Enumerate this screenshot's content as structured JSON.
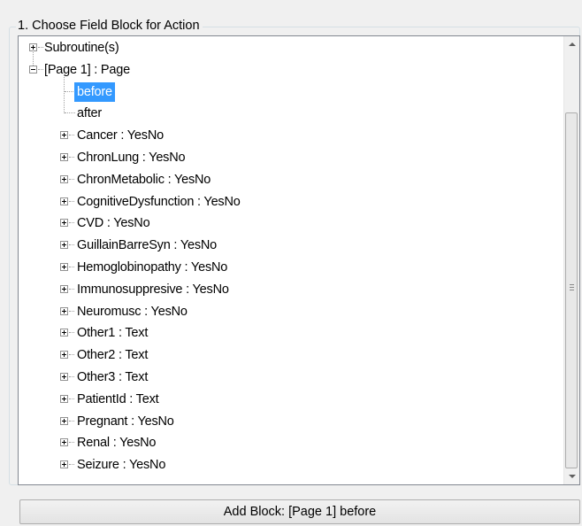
{
  "groupbox": {
    "title": "1. Choose Field Block for Action"
  },
  "tree": {
    "root_nodes": [
      {
        "label": "Subroutine(s)",
        "expanded": false
      },
      {
        "label": "[Page 1] : Page",
        "expanded": true
      }
    ],
    "page_children": [
      {
        "label": "before",
        "selected": true,
        "expander": false
      },
      {
        "label": "after",
        "selected": false,
        "expander": false
      },
      {
        "label": "Cancer : YesNo",
        "expander": true
      },
      {
        "label": "ChronLung : YesNo",
        "expander": true
      },
      {
        "label": "ChronMetabolic : YesNo",
        "expander": true
      },
      {
        "label": "CognitiveDysfunction : YesNo",
        "expander": true
      },
      {
        "label": "CVD : YesNo",
        "expander": true
      },
      {
        "label": "GuillainBarreSyn : YesNo",
        "expander": true
      },
      {
        "label": "Hemoglobinopathy : YesNo",
        "expander": true
      },
      {
        "label": "Immunosuppresive : YesNo",
        "expander": true
      },
      {
        "label": "Neuromusc : YesNo",
        "expander": true
      },
      {
        "label": "Other1 : Text",
        "expander": true
      },
      {
        "label": "Other2 : Text",
        "expander": true
      },
      {
        "label": "Other3 : Text",
        "expander": true
      },
      {
        "label": "PatientId : Text",
        "expander": true
      },
      {
        "label": "Pregnant : YesNo",
        "expander": true
      },
      {
        "label": "Renal : YesNo",
        "expander": true
      },
      {
        "label": "Seizure : YesNo",
        "expander": true
      }
    ]
  },
  "add_button": {
    "label": "Add Block: [Page 1] before"
  },
  "colors": {
    "selection": "#3399ff",
    "tree_border": "#828790",
    "background": "#f0f0f0"
  }
}
